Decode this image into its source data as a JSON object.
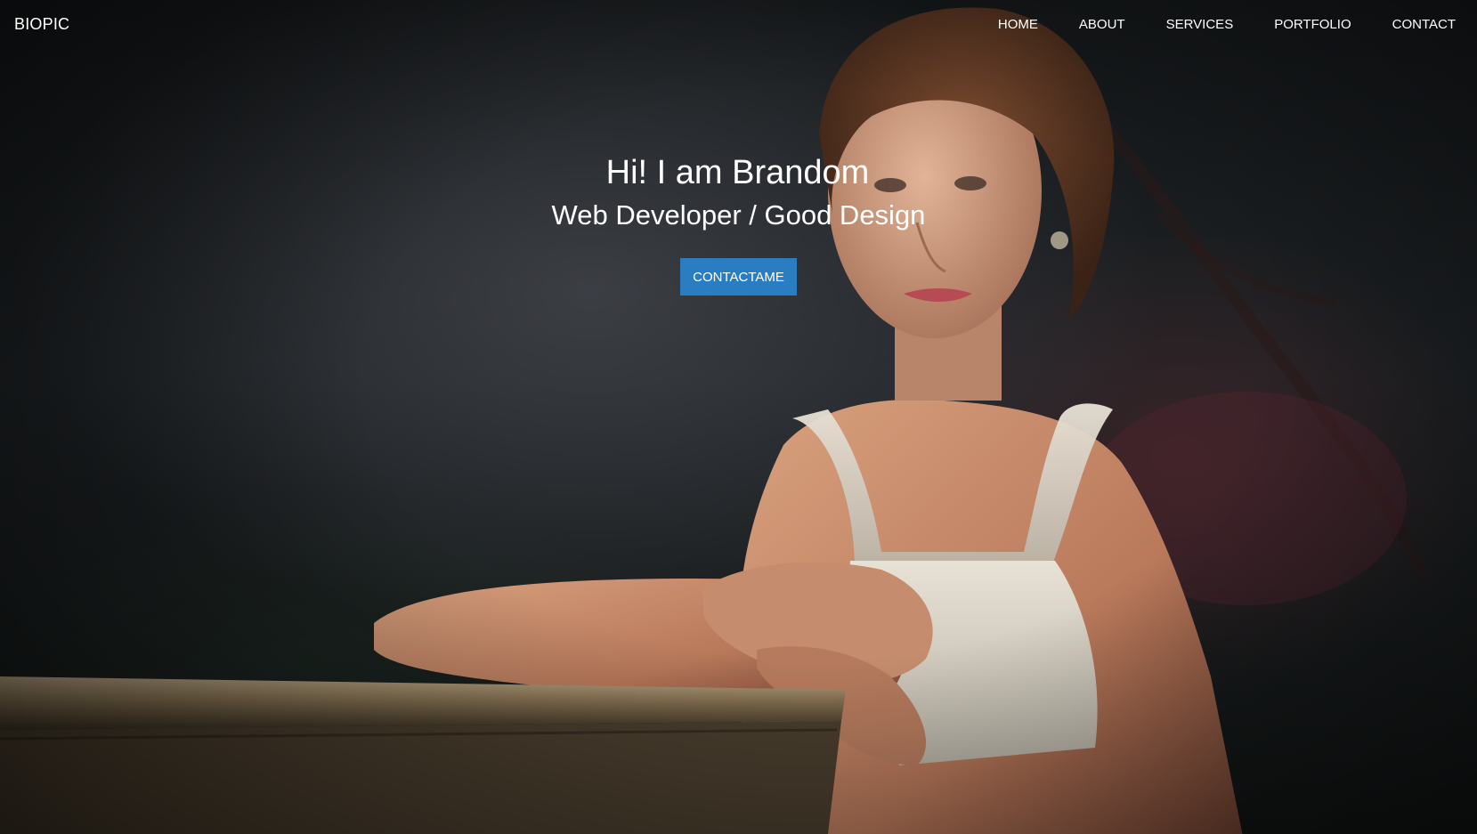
{
  "nav": {
    "brand": "BIOPIC",
    "links": [
      "HOME",
      "ABOUT",
      "SERVICES",
      "PORTFOLIO",
      "CONTACT"
    ]
  },
  "hero": {
    "title": "Hi! I am Brandom",
    "subtitle": "Web Developer / Good Design",
    "cta_label": "CONTACTAME",
    "cta_color": "#2a7dc1"
  }
}
